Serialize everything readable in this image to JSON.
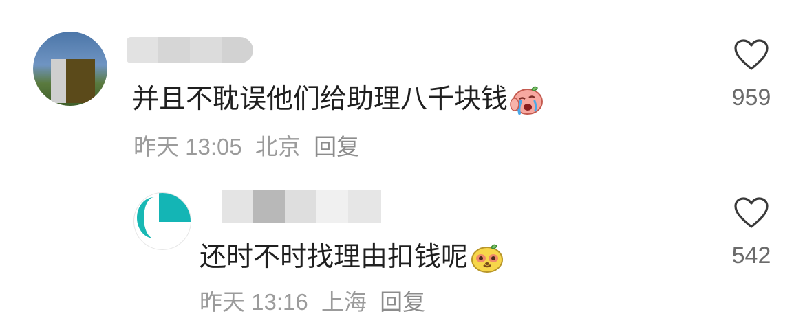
{
  "comments": [
    {
      "text": "并且不耽误他们给助理八千块钱",
      "emoji": "crying-face-emoji",
      "time": "昨天 13:05",
      "location": "北京",
      "reply_label": "回复",
      "likes": "959"
    },
    {
      "text": "还时不时找理由扣钱呢",
      "emoji": "smirking-face-emoji",
      "time": "昨天 13:16",
      "location": "上海",
      "reply_label": "回复",
      "likes": "542"
    }
  ],
  "icons": {
    "like": "heart-outline-icon"
  },
  "colors": {
    "text": "#1f1f1f",
    "meta": "#9b9b9b",
    "count": "#6b6b6b",
    "teal_avatar": "#14b5b5"
  }
}
